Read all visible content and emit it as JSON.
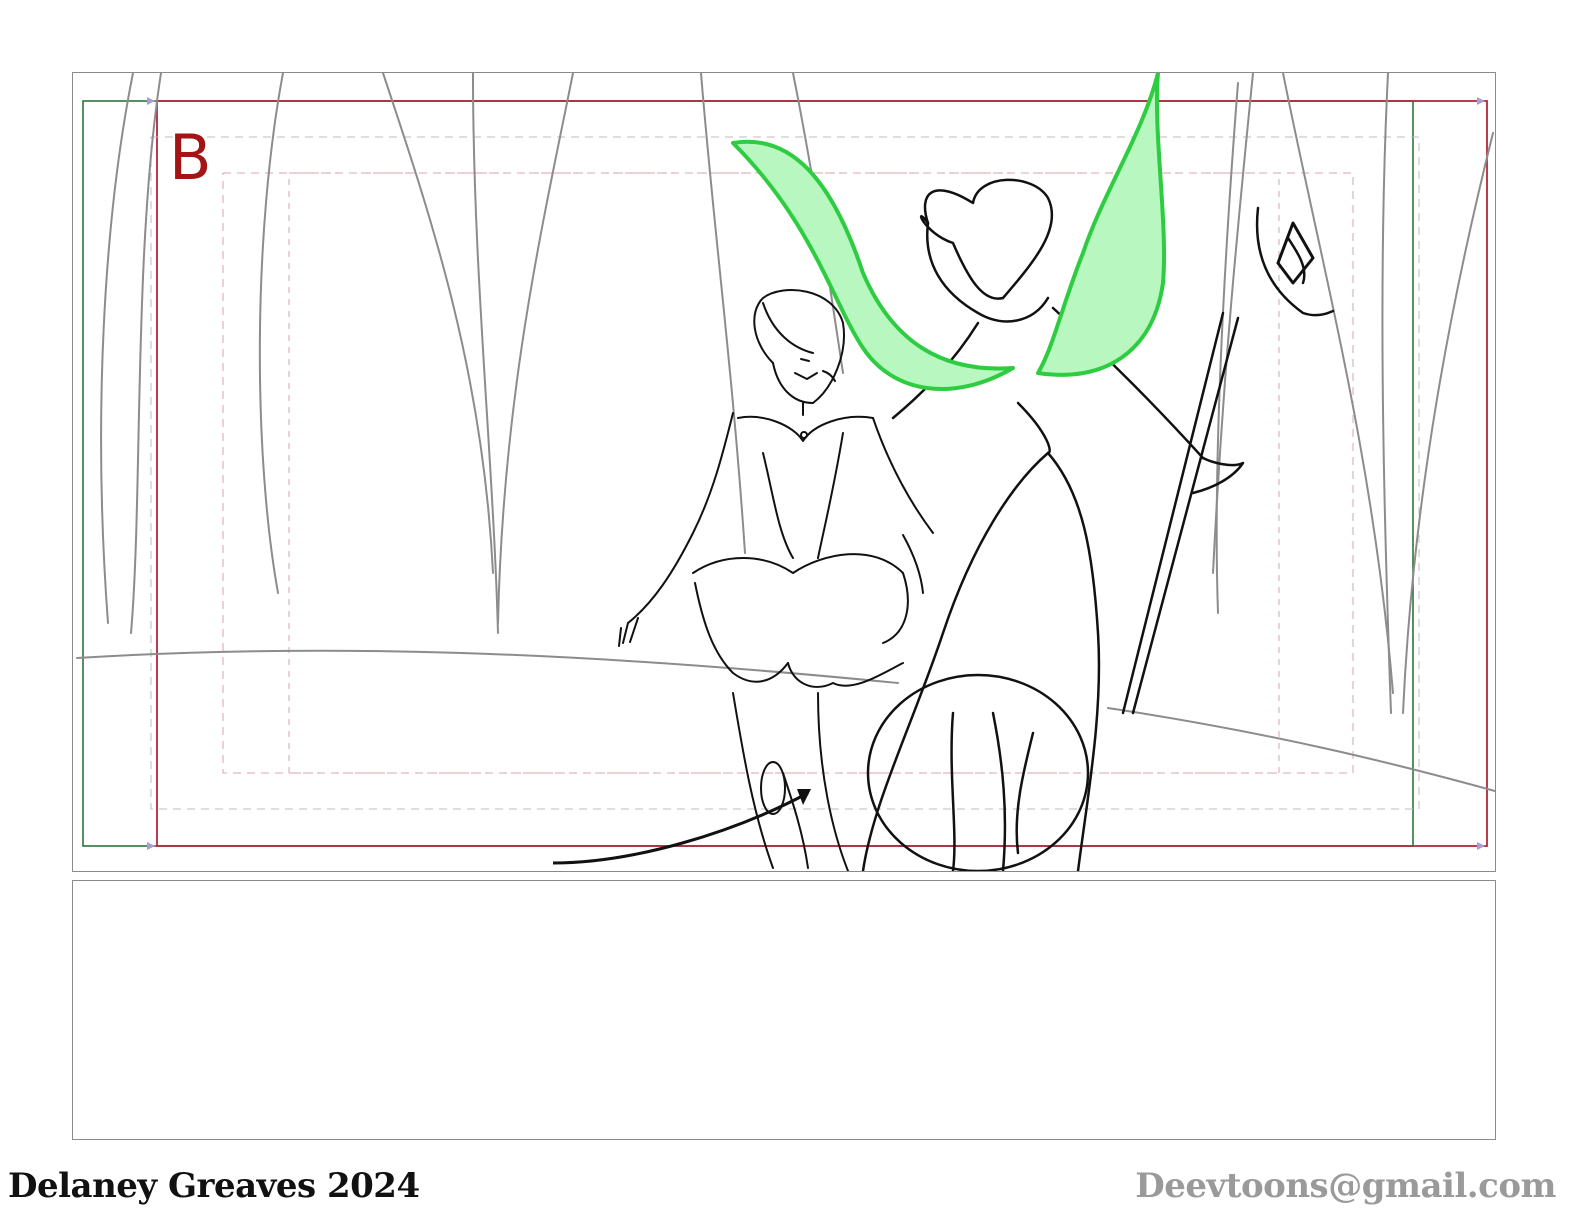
{
  "panel": {
    "label": "B"
  },
  "footer": {
    "artist": "Delaney Greaves 2024",
    "contact": "Deevtoons@gmail.com"
  },
  "colors": {
    "panel_label": "#a31515",
    "title_safe": "#b0283a",
    "action_safe": "#1f6b2f",
    "guide_dashed": "#d7a4ae",
    "wing_fill": "#b8f7c0",
    "wing_stroke": "#2ecc40",
    "line_art": "#111111",
    "background_lines": "#8c8c8c",
    "arrow_marker": "#a89bd6"
  },
  "icons": {
    "field_arrows": "triangle-arrow-icon"
  }
}
